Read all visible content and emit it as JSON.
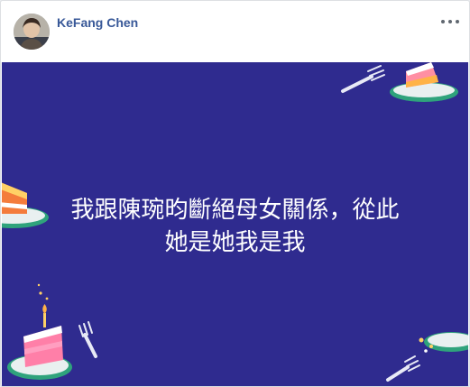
{
  "post": {
    "author": "KeFang Chen",
    "text_line1": "我跟陳琬昀斷絕母女關係，從此",
    "text_line2": "她是她我是我",
    "background_color": "#2f2b8f"
  },
  "icons": {
    "more": "more-options-icon",
    "avatar": "profile-photo"
  }
}
